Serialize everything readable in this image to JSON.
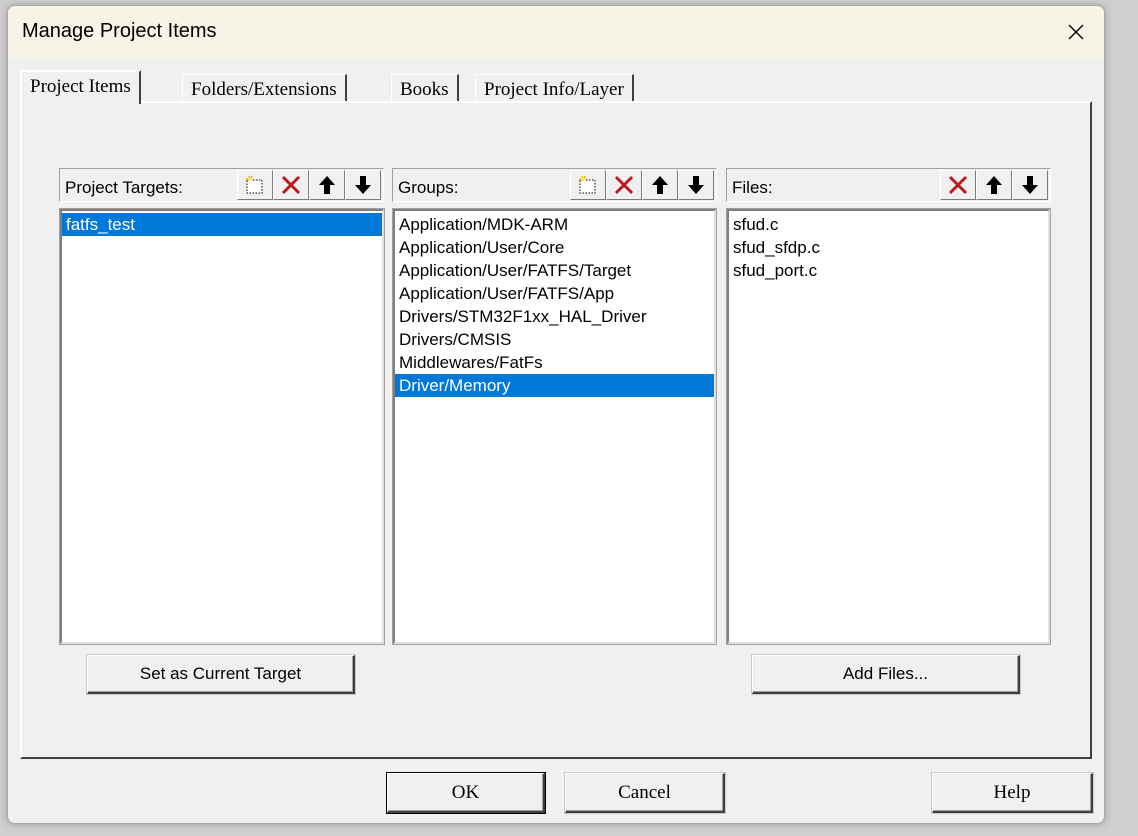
{
  "window": {
    "title": "Manage Project Items"
  },
  "tabs": [
    {
      "label": "Project Items",
      "active": true
    },
    {
      "label": "Folders/Extensions",
      "active": false
    },
    {
      "label": "Books",
      "active": false
    },
    {
      "label": "Project Info/Layer",
      "active": false
    }
  ],
  "targets": {
    "header": "Project Targets:",
    "items": [
      "fatfs_test"
    ],
    "selected_index": 0,
    "button_label": "Set as Current Target"
  },
  "groups": {
    "header": "Groups:",
    "items": [
      "Application/MDK-ARM",
      "Application/User/Core",
      "Application/User/FATFS/Target",
      "Application/User/FATFS/App",
      "Drivers/STM32F1xx_HAL_Driver",
      "Drivers/CMSIS",
      "Middlewares/FatFs",
      "Driver/Memory"
    ],
    "selected_index": 7
  },
  "files": {
    "header": "Files:",
    "items": [
      "sfud.c",
      "sfud_sfdp.c",
      "sfud_port.c"
    ],
    "button_label": "Add Files..."
  },
  "footer": {
    "ok_label": "OK",
    "cancel_label": "Cancel",
    "help_label": "Help"
  },
  "colors": {
    "selection": "#0078d7",
    "delete_icon": "#c0161d",
    "titlebar": "#f7f3e6"
  },
  "icons": {
    "new": "new-item-icon",
    "delete": "delete-icon",
    "move_up": "move-up-icon",
    "move_down": "move-down-icon",
    "close": "close-icon"
  }
}
